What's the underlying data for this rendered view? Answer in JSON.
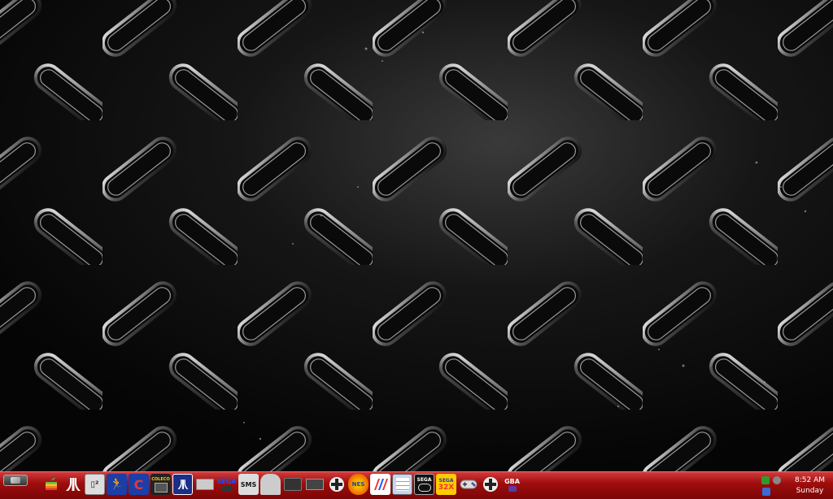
{
  "desktop": {
    "wallpaper": "diamond-plate-metal"
  },
  "taskbar": {
    "start_icon": "start-button",
    "quick_launch": [
      {
        "name": "apple-icon",
        "label": ""
      },
      {
        "name": "atari-icon",
        "label": ""
      },
      {
        "name": "atari-2600-icon",
        "label": ""
      },
      {
        "name": "runner-icon",
        "label": ""
      },
      {
        "name": "magnet-icon",
        "label": "C"
      },
      {
        "name": "colecovision-icon",
        "label": "COLECO"
      },
      {
        "name": "atari-logo-icon",
        "label": ""
      },
      {
        "name": "nes-console-icon",
        "label": ""
      },
      {
        "name": "sega-genesis-icon",
        "label": "SEGA"
      },
      {
        "name": "sms-icon",
        "label": "SMS"
      },
      {
        "name": "dome-icon",
        "label": ""
      },
      {
        "name": "console-icon",
        "label": ""
      },
      {
        "name": "console-2-icon",
        "label": ""
      },
      {
        "name": "dpad-icon",
        "label": ""
      },
      {
        "name": "nes-emulator-icon",
        "label": "NES"
      },
      {
        "name": "stripes-icon",
        "label": ""
      },
      {
        "name": "window-icon",
        "label": ""
      },
      {
        "name": "sega-cd-icon",
        "label": "SEGA"
      },
      {
        "name": "sega-32x-icon",
        "label": "SEGA"
      },
      {
        "name": "snes-pad-icon",
        "label": ""
      },
      {
        "name": "dpad-2-icon",
        "label": ""
      },
      {
        "name": "gba-icon",
        "label": "GBA"
      }
    ],
    "clock": {
      "time": "8:52 AM",
      "day": "Sunday"
    }
  }
}
